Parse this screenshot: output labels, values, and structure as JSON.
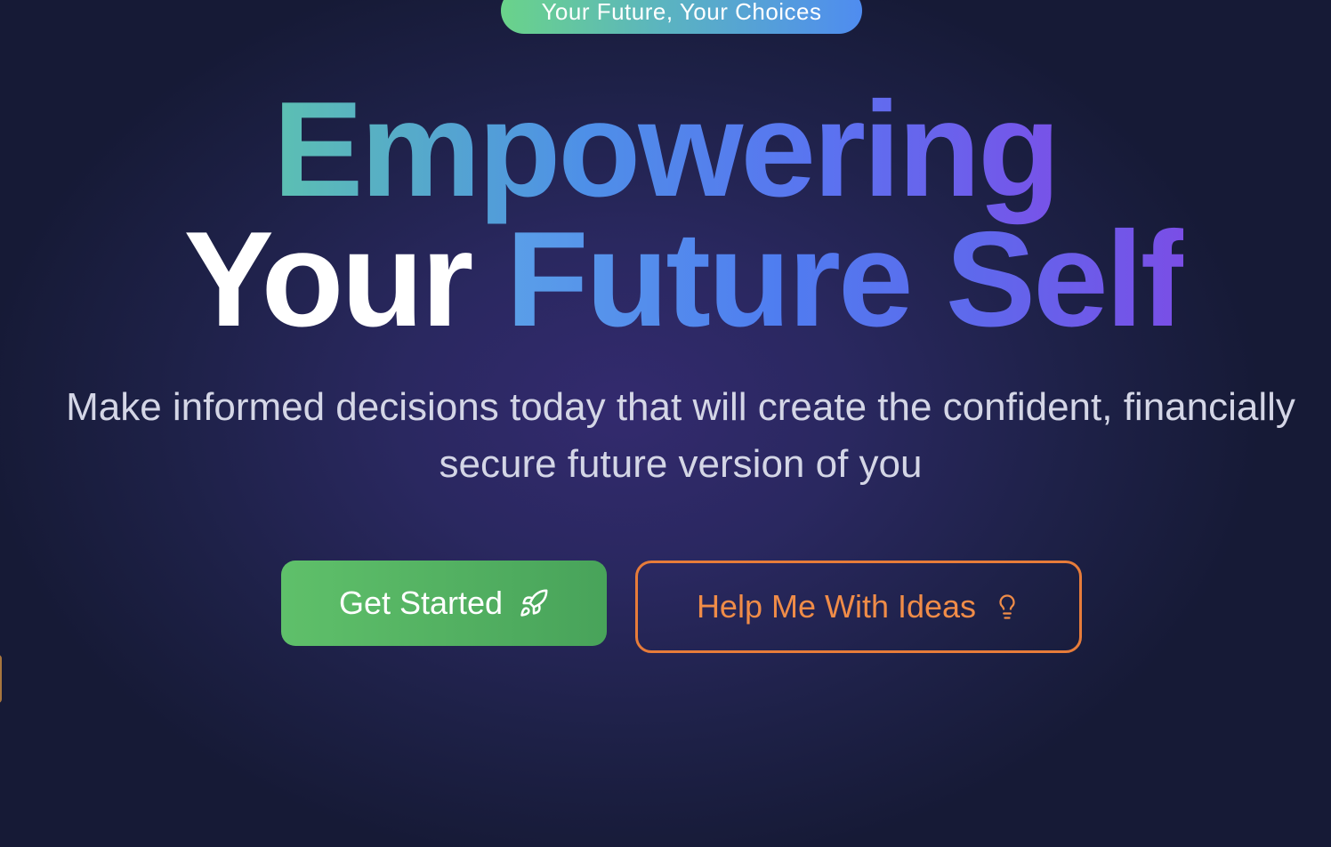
{
  "badge": {
    "label": "Your Future, Your Choices"
  },
  "hero": {
    "line1": "Empowering",
    "line2_white": "Your",
    "line2_gradient": "Future Self",
    "subtitle_line1": "Make informed decisions today that will create the confident, financially",
    "subtitle_line2": "secure future version of you"
  },
  "actions": {
    "primary_label": "Get Started",
    "primary_icon": "rocket-icon",
    "secondary_label": "Help Me With Ideas",
    "secondary_icon": "lightbulb-icon"
  },
  "colors": {
    "primary_button": "#5fc06a",
    "secondary_border": "#e77c3a",
    "secondary_text": "#f08c48",
    "background": "#1e2148"
  }
}
